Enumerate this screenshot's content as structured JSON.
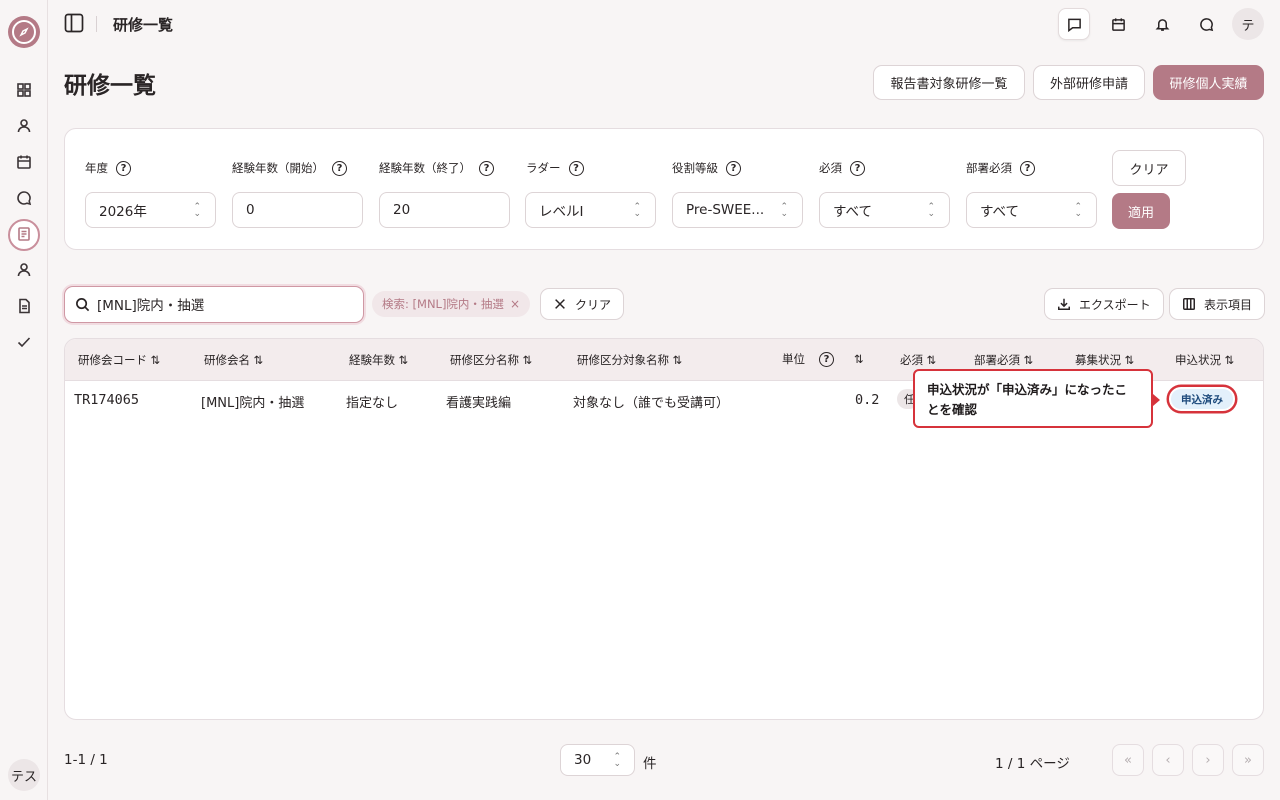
{
  "header": {
    "title": "研修一覧",
    "user_initial": "テ"
  },
  "sidebar": {
    "user_label": "テス"
  },
  "page": {
    "title": "研修一覧",
    "buttons": [
      "報告書対象研修一覧",
      "外部研修申請",
      "研修個人実績"
    ]
  },
  "filters": {
    "year": {
      "label": "年度",
      "value": "2026年"
    },
    "exp_start": {
      "label": "経験年数（開始）",
      "value": "0"
    },
    "exp_end": {
      "label": "経験年数（終了）",
      "value": "20"
    },
    "ladder": {
      "label": "ラダー",
      "value": "レベルI"
    },
    "role": {
      "label": "役割等級",
      "value": "Pre-SWEE..."
    },
    "required": {
      "label": "必須",
      "value": "すべて"
    },
    "dept_required": {
      "label": "部署必須",
      "value": "すべて"
    },
    "clear_label": "クリア",
    "apply_label": "適用"
  },
  "toolbar": {
    "search_value": "[MNL]院内・抽選",
    "chip_label": "検索: [MNL]院内・抽選",
    "clear_label": "クリア",
    "export_label": "エクスポート",
    "columns_label": "表示項目"
  },
  "table": {
    "headers": [
      "研修会コード",
      "研修会名",
      "経験年数",
      "研修区分名称",
      "研修区分対象名称",
      "単位",
      "必須",
      "部署必須",
      "募集状況",
      "申込状況"
    ],
    "rows": [
      {
        "code": "TR174065",
        "name": "[MNL]院内・抽選",
        "experience": "指定なし",
        "category": "看護実践編",
        "target": "対象なし（誰でも受講可）",
        "units": "0.2",
        "required": "任",
        "status": "申込済み"
      }
    ]
  },
  "callout": {
    "text": "申込状況が「申込済み」になったことを確認"
  },
  "pagination": {
    "range": "1-1 / 1",
    "per_page": "30",
    "per_page_unit": "件",
    "page_info": "1 / 1 ページ"
  }
}
